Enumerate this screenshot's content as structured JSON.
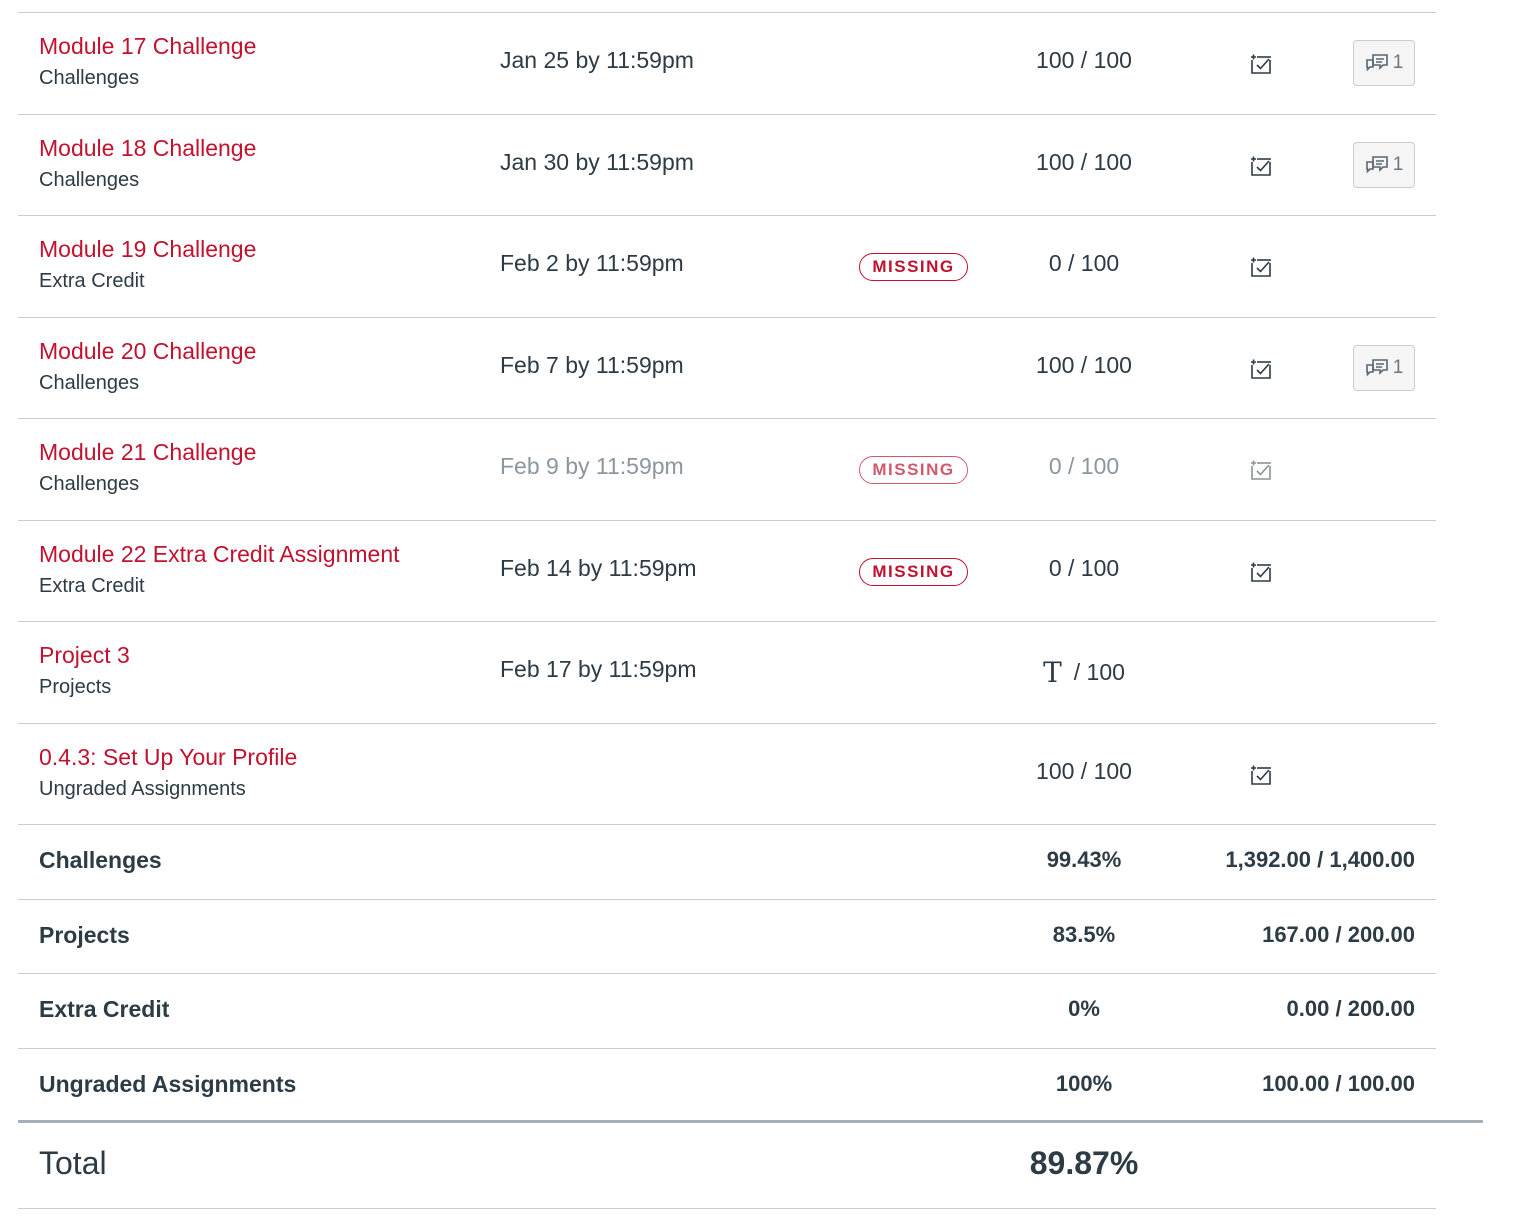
{
  "assignments": [
    {
      "title": "Module 17 Challenge",
      "context": "Challenges",
      "due": "Jan 25 by 11:59pm",
      "badge": "",
      "score": "100 / 100",
      "rubric_icon": "rubric-icon",
      "comments_count": "1"
    },
    {
      "title": "Module 18 Challenge",
      "context": "Challenges",
      "due": "Jan 30 by 11:59pm",
      "badge": "",
      "score": "100 / 100",
      "rubric_icon": "rubric-icon",
      "comments_count": "1"
    },
    {
      "title": "Module 19 Challenge",
      "context": "Extra Credit",
      "due": "Feb 2 by 11:59pm",
      "badge": "MISSING",
      "score": "0 / 100",
      "rubric_icon": "rubric-icon",
      "comments_count": ""
    },
    {
      "title": "Module 20 Challenge",
      "context": "Challenges",
      "due": "Feb 7 by 11:59pm",
      "badge": "",
      "score": "100 / 100",
      "rubric_icon": "rubric-icon",
      "comments_count": "1"
    },
    {
      "title": "Module 21 Challenge",
      "context": "Challenges",
      "due": "Feb 9 by 11:59pm",
      "badge": "MISSING",
      "score": "0 / 100",
      "rubric_icon": "rubric-icon",
      "comments_count": "",
      "muted": true
    },
    {
      "title": "Module 22 Extra Credit Assignment",
      "context": "Extra Credit",
      "due": "Feb 14 by 11:59pm",
      "badge": "MISSING",
      "score": "0 / 100",
      "rubric_icon": "rubric-icon",
      "comments_count": ""
    },
    {
      "title": "Project 3",
      "context": "Projects",
      "due": "Feb 17 by 11:59pm",
      "badge": "",
      "score_icon": "text-entry-icon",
      "score_icon_glyph": "T",
      "score": "/ 100",
      "comments_count": ""
    },
    {
      "title": "0.4.3: Set Up Your Profile",
      "context": "Ungraded Assignments",
      "due": "",
      "badge": "",
      "score": "100 / 100",
      "rubric_icon": "rubric-icon",
      "comments_count": ""
    }
  ],
  "groups": [
    {
      "name": "Challenges",
      "percent": "99.43%",
      "points": "1,392.00 / 1,400.00"
    },
    {
      "name": "Projects",
      "percent": "83.5%",
      "points": "167.00 / 200.00"
    },
    {
      "name": "Extra Credit",
      "percent": "0%",
      "points": "0.00 / 200.00"
    },
    {
      "name": "Ungraded Assignments",
      "percent": "100%",
      "points": "100.00 / 100.00"
    }
  ],
  "total": {
    "label": "Total",
    "percent": "89.87%"
  },
  "colors": {
    "link": "#c1122f",
    "text": "#2d3b45",
    "muted": "#8b969e",
    "rule": "#c7cdd1"
  }
}
